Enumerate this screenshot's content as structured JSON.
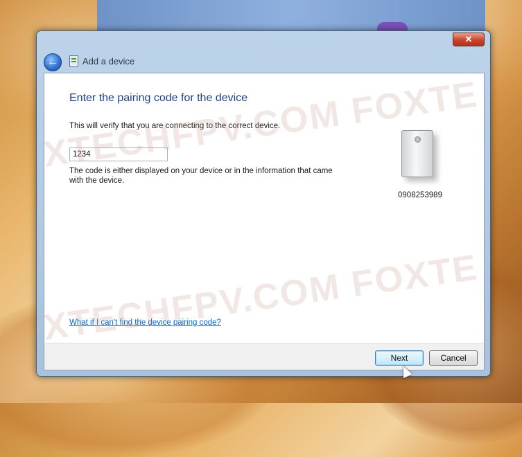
{
  "window": {
    "title": "Add a device",
    "close_label": "✕"
  },
  "page": {
    "heading": "Enter the pairing code for the device",
    "subtext": "This will verify that you are connecting to the correct device.",
    "code_value": "1234",
    "help_text": "The code is either displayed on your device or in the information that came with the device.",
    "device_name": "0908253989",
    "help_link": "What if I can't find the device pairing code?"
  },
  "buttons": {
    "next": "Next",
    "cancel": "Cancel"
  },
  "watermark": {
    "top": "XTECHFPV.COM FOXTE",
    "bottom": "XTECHFPV.COM FOXTE"
  }
}
